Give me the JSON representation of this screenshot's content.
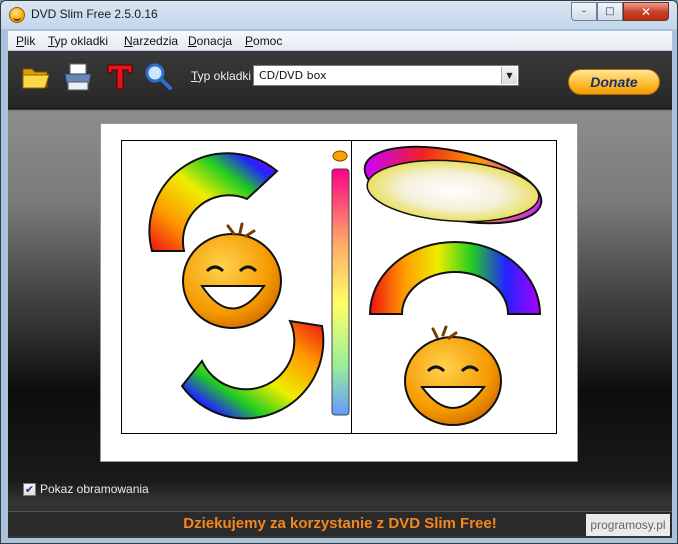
{
  "window": {
    "title": "DVD Slim Free 2.5.0.16",
    "controls": {
      "minimize": "–",
      "maximize": "□",
      "close": "✕"
    }
  },
  "menu": {
    "items": [
      {
        "underline": "P",
        "rest": "lik"
      },
      {
        "underline": "T",
        "rest": "yp okladki"
      },
      {
        "underline": "N",
        "rest": "arzedzia"
      },
      {
        "underline": "D",
        "rest": "onacja"
      },
      {
        "underline": "P",
        "rest": "omoc"
      }
    ]
  },
  "toolbar": {
    "tools": [
      "folder-open-icon",
      "printer-icon",
      "text-icon",
      "magnifier-icon"
    ],
    "cover_type_label_underline": "T",
    "cover_type_label_rest": "yp okladki",
    "cover_type_value": "CD/DVD box",
    "donate_label": "Donate"
  },
  "options": {
    "show_border_checked": true,
    "show_border_check_mark": "✔",
    "show_border_label": "Pokaz obramowania"
  },
  "footer": {
    "thanks_text": "Dziekujemy za korzystanie z DVD Slim Free!"
  },
  "watermark": {
    "text": "programosy.pl"
  },
  "colors": {
    "accent_orange": "#f5871f",
    "donate_text": "#1a2e6b"
  }
}
